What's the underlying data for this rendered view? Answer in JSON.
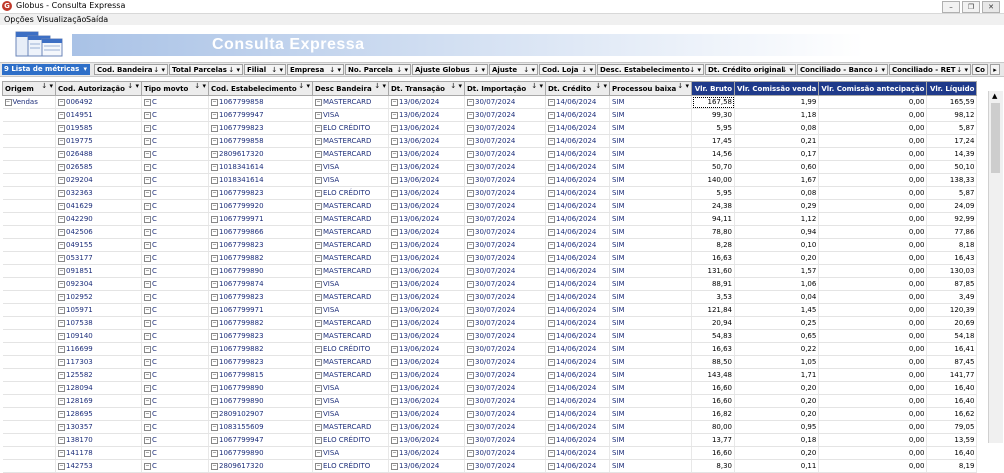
{
  "window": {
    "title": "Globus - Consulta Expressa",
    "app_icon": "G"
  },
  "menu": [
    "Opções",
    "Visualização",
    "Saída"
  ],
  "banner_title": "Consulta Expressa",
  "toolbar": {
    "metrics_count": "9",
    "metrics_label": "Lista de métricas",
    "fields": [
      "Cod. Bandeira",
      "Total Parcelas",
      "Filial",
      "Empresa",
      "No. Parcela",
      "Ajuste Globus",
      "Ajuste",
      "Cod. Loja",
      "Desc. Estabelecimento",
      "Dt. Crédito original",
      "Conciliado - Banco",
      "Conciliado - RET",
      "Co"
    ]
  },
  "columns": [
    "Origem",
    "Cod. Autorização",
    "Tipo movto",
    "Cod. Estabelecimento",
    "Desc Bandeira",
    "Dt. Transação",
    "Dt. Importação",
    "Dt. Crédito",
    "Processou baixa",
    "Vlr. Bruto",
    "Vlr. Comissão venda",
    "Vlr. Comissão antecipação",
    "Vlr. Líquido"
  ],
  "origem": "Vendas",
  "rows": [
    [
      "006492",
      "C",
      "1067799858",
      "MASTERCARD",
      "13/06/2024",
      "30/07/2024",
      "14/06/2024",
      "SIM",
      "167,58",
      "1,99",
      "0,00",
      "165,59"
    ],
    [
      "014951",
      "C",
      "1067799947",
      "VISA",
      "13/06/2024",
      "30/07/2024",
      "14/06/2024",
      "SIM",
      "99,30",
      "1,18",
      "0,00",
      "98,12"
    ],
    [
      "019585",
      "C",
      "1067799823",
      "ELO CRÉDITO",
      "13/06/2024",
      "30/07/2024",
      "14/06/2024",
      "SIM",
      "5,95",
      "0,08",
      "0,00",
      "5,87"
    ],
    [
      "019775",
      "C",
      "1067799858",
      "MASTERCARD",
      "13/06/2024",
      "30/07/2024",
      "14/06/2024",
      "SIM",
      "17,45",
      "0,21",
      "0,00",
      "17,24"
    ],
    [
      "026488",
      "C",
      "2809617320",
      "MASTERCARD",
      "13/06/2024",
      "30/07/2024",
      "14/06/2024",
      "SIM",
      "14,56",
      "0,17",
      "0,00",
      "14,39"
    ],
    [
      "026585",
      "C",
      "1018341614",
      "VISA",
      "13/06/2024",
      "30/07/2024",
      "14/06/2024",
      "SIM",
      "50,70",
      "0,60",
      "0,00",
      "50,10"
    ],
    [
      "029204",
      "C",
      "1018341614",
      "VISA",
      "13/06/2024",
      "30/07/2024",
      "14/06/2024",
      "SIM",
      "140,00",
      "1,67",
      "0,00",
      "138,33"
    ],
    [
      "032363",
      "C",
      "1067799823",
      "ELO CRÉDITO",
      "13/06/2024",
      "30/07/2024",
      "14/06/2024",
      "SIM",
      "5,95",
      "0,08",
      "0,00",
      "5,87"
    ],
    [
      "041629",
      "C",
      "1067799920",
      "MASTERCARD",
      "13/06/2024",
      "30/07/2024",
      "14/06/2024",
      "SIM",
      "24,38",
      "0,29",
      "0,00",
      "24,09"
    ],
    [
      "042290",
      "C",
      "1067799971",
      "MASTERCARD",
      "13/06/2024",
      "30/07/2024",
      "14/06/2024",
      "SIM",
      "94,11",
      "1,12",
      "0,00",
      "92,99"
    ],
    [
      "042506",
      "C",
      "1067799866",
      "MASTERCARD",
      "13/06/2024",
      "30/07/2024",
      "14/06/2024",
      "SIM",
      "78,80",
      "0,94",
      "0,00",
      "77,86"
    ],
    [
      "049155",
      "C",
      "1067799823",
      "MASTERCARD",
      "13/06/2024",
      "30/07/2024",
      "14/06/2024",
      "SIM",
      "8,28",
      "0,10",
      "0,00",
      "8,18"
    ],
    [
      "053177",
      "C",
      "1067799882",
      "MASTERCARD",
      "13/06/2024",
      "30/07/2024",
      "14/06/2024",
      "SIM",
      "16,63",
      "0,20",
      "0,00",
      "16,43"
    ],
    [
      "091851",
      "C",
      "1067799890",
      "MASTERCARD",
      "13/06/2024",
      "30/07/2024",
      "14/06/2024",
      "SIM",
      "131,60",
      "1,57",
      "0,00",
      "130,03"
    ],
    [
      "092304",
      "C",
      "1067799874",
      "VISA",
      "13/06/2024",
      "30/07/2024",
      "14/06/2024",
      "SIM",
      "88,91",
      "1,06",
      "0,00",
      "87,85"
    ],
    [
      "102952",
      "C",
      "1067799823",
      "MASTERCARD",
      "13/06/2024",
      "30/07/2024",
      "14/06/2024",
      "SIM",
      "3,53",
      "0,04",
      "0,00",
      "3,49"
    ],
    [
      "105971",
      "C",
      "1067799971",
      "VISA",
      "13/06/2024",
      "30/07/2024",
      "14/06/2024",
      "SIM",
      "121,84",
      "1,45",
      "0,00",
      "120,39"
    ],
    [
      "107538",
      "C",
      "1067799882",
      "MASTERCARD",
      "13/06/2024",
      "30/07/2024",
      "14/06/2024",
      "SIM",
      "20,94",
      "0,25",
      "0,00",
      "20,69"
    ],
    [
      "109140",
      "C",
      "1067799823",
      "MASTERCARD",
      "13/06/2024",
      "30/07/2024",
      "14/06/2024",
      "SIM",
      "54,83",
      "0,65",
      "0,00",
      "54,18"
    ],
    [
      "116699",
      "C",
      "1067799882",
      "ELO CRÉDITO",
      "13/06/2024",
      "30/07/2024",
      "14/06/2024",
      "SIM",
      "16,63",
      "0,22",
      "0,00",
      "16,41"
    ],
    [
      "117303",
      "C",
      "1067799823",
      "MASTERCARD",
      "13/06/2024",
      "30/07/2024",
      "14/06/2024",
      "SIM",
      "88,50",
      "1,05",
      "0,00",
      "87,45"
    ],
    [
      "125582",
      "C",
      "1067799815",
      "MASTERCARD",
      "13/06/2024",
      "30/07/2024",
      "14/06/2024",
      "SIM",
      "143,48",
      "1,71",
      "0,00",
      "141,77"
    ],
    [
      "128094",
      "C",
      "1067799890",
      "VISA",
      "13/06/2024",
      "30/07/2024",
      "14/06/2024",
      "SIM",
      "16,60",
      "0,20",
      "0,00",
      "16,40"
    ],
    [
      "128169",
      "C",
      "1067799890",
      "VISA",
      "13/06/2024",
      "30/07/2024",
      "14/06/2024",
      "SIM",
      "16,60",
      "0,20",
      "0,00",
      "16,40"
    ],
    [
      "128695",
      "C",
      "2809102907",
      "VISA",
      "13/06/2024",
      "30/07/2024",
      "14/06/2024",
      "SIM",
      "16,82",
      "0,20",
      "0,00",
      "16,62"
    ],
    [
      "130357",
      "C",
      "1083155609",
      "MASTERCARD",
      "13/06/2024",
      "30/07/2024",
      "14/06/2024",
      "SIM",
      "80,00",
      "0,95",
      "0,00",
      "79,05"
    ],
    [
      "138170",
      "C",
      "1067799947",
      "ELO CRÉDITO",
      "13/06/2024",
      "30/07/2024",
      "14/06/2024",
      "SIM",
      "13,77",
      "0,18",
      "0,00",
      "13,59"
    ],
    [
      "141178",
      "C",
      "1067799890",
      "VISA",
      "13/06/2024",
      "30/07/2024",
      "14/06/2024",
      "SIM",
      "16,60",
      "0,20",
      "0,00",
      "16,40"
    ],
    [
      "142753",
      "C",
      "2809617320",
      "ELO CRÉDITO",
      "13/06/2024",
      "30/07/2024",
      "14/06/2024",
      "SIM",
      "8,30",
      "0,11",
      "0,00",
      "8,19"
    ]
  ],
  "colors": {
    "accent": "#1f3a8a",
    "metrics_button": "#2e6fc8",
    "banner": "#a9c2e6"
  }
}
